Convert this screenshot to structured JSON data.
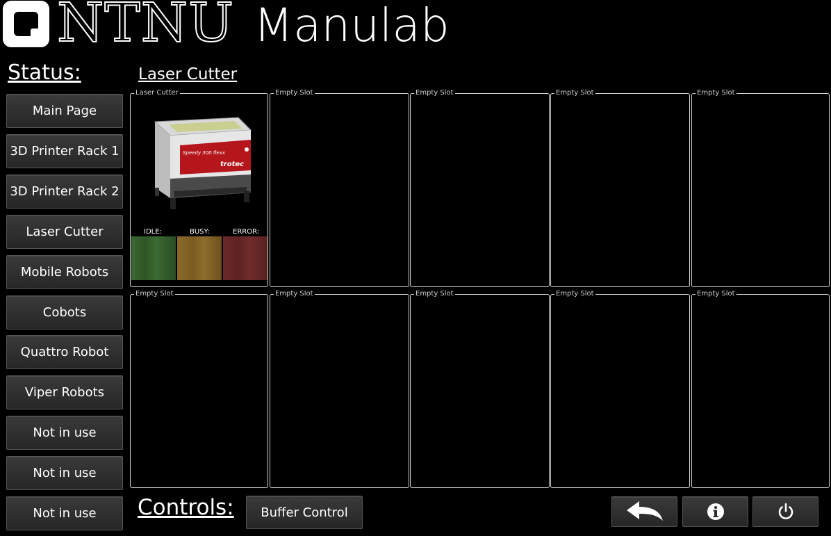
{
  "header": {
    "brand": "NTNU",
    "app_name": "Manulab"
  },
  "status_heading": "Status:",
  "section_title": "Laser Cutter",
  "controls_heading": "Controls:",
  "nav": [
    {
      "label": "Main Page"
    },
    {
      "label": "3D Printer Rack 1"
    },
    {
      "label": "3D Printer Rack 2"
    },
    {
      "label": "Laser Cutter"
    },
    {
      "label": "Mobile Robots"
    },
    {
      "label": "Cobots"
    },
    {
      "label": "Quattro Robot"
    },
    {
      "label": "Viper Robots"
    },
    {
      "label": "Not in use"
    },
    {
      "label": "Not in use"
    },
    {
      "label": "Not in use"
    }
  ],
  "slots": [
    {
      "label": "Laser Cutter"
    },
    {
      "label": "Empty Slot"
    },
    {
      "label": "Empty Slot"
    },
    {
      "label": "Empty Slot"
    },
    {
      "label": "Empty Slot"
    },
    {
      "label": "Empty Slot"
    },
    {
      "label": "Empty Slot"
    },
    {
      "label": "Empty Slot"
    },
    {
      "label": "Empty Slot"
    },
    {
      "label": "Empty Slot"
    }
  ],
  "machine": {
    "brand_text": "trotec",
    "model_text": "Speedy 300 flexx",
    "states": {
      "idle": "IDLE:",
      "busy": "BUSY:",
      "error": "ERROR:"
    }
  },
  "controls": {
    "buffer_label": "Buffer Control",
    "back_icon": "back-arrow-icon",
    "info_icon": "info-icon",
    "power_icon": "power-icon"
  },
  "colors": {
    "idle": "#3d6a35",
    "busy": "#8a6a2a",
    "error": "#6b2a29"
  }
}
